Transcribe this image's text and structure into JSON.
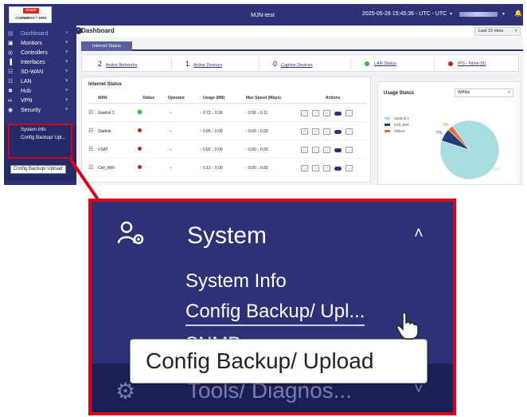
{
  "topbar": {
    "logo_top": "ezuzo",
    "logo_bottom": "COMMBOX™ EDG",
    "app_title": "MJN-test",
    "datetime": "2025-05-28 15:45:36 - UTC - UTC",
    "caret": "▾",
    "bell": "🔔"
  },
  "sidebar": {
    "items": [
      {
        "icon": "▤",
        "label": "Dashboard",
        "active": true
      },
      {
        "icon": "▣",
        "label": "Monitors"
      },
      {
        "icon": "◎",
        "label": "Controllers"
      },
      {
        "icon": "▐",
        "label": "Interfaces"
      },
      {
        "icon": "☷",
        "label": "SD-WAN"
      },
      {
        "icon": "☷",
        "label": "LAN"
      },
      {
        "icon": "✱",
        "label": "Hub"
      },
      {
        "icon": "∞",
        "label": "VPN"
      },
      {
        "icon": "◉",
        "label": "Security"
      }
    ],
    "chevron": "˅",
    "submenu": [
      "System Info",
      "Config Backup/ Upl..."
    ],
    "tooltip": "Config Backup/ Upload"
  },
  "main": {
    "page_title": "Dashboard",
    "time_range": "Last 15 mins",
    "tab": "Internet Status",
    "stats": [
      {
        "count": "2",
        "label": "Active Networks"
      },
      {
        "count": "1",
        "label": "Active Devices"
      },
      {
        "count": "0",
        "label": "Captive Devices"
      },
      {
        "label": "LAN Status",
        "color": "#3cb44b"
      },
      {
        "label": "IPS - None (0)",
        "color": "#b3261e"
      }
    ]
  },
  "internet_status": {
    "title": "Internet Status",
    "columns": [
      "WAN",
      "Status",
      "Operator",
      "Usage (MB)",
      "Max Speed (Mbps)",
      "Actions"
    ],
    "rows": [
      {
        "wan": "Starlink 2",
        "status": "green",
        "operator": "–",
        "usage": "↑ 0.72  ↓ 0.99",
        "speed": "↑ 0.06  ↓ 0.11"
      },
      {
        "wan": "Starlink",
        "status": "red",
        "operator": "–",
        "usage": "↑ 0.05  ↓ 0.00",
        "speed": "↑ 0.00  ↓ 0.00"
      },
      {
        "wan": "VSAT",
        "status": "red",
        "operator": "–",
        "usage": "↑ 0.02  ↓ 0.00",
        "speed": "↑ 0.00  ↓ 0.00"
      },
      {
        "wan": "Cell_WiFi",
        "status": "red",
        "operator": "–",
        "usage": "↑ 0.13  ↓ 0.00",
        "speed": "↑ 0.00  ↓ 0.00"
      }
    ],
    "status_colors": {
      "green": "#3cb44b",
      "red": "#b3261e"
    },
    "action_icons": [
      "chart-icon",
      "settings-icon",
      "speed-icon",
      "toggle-icon",
      "arrow-right-icon"
    ]
  },
  "usage_status": {
    "title": "Usage Status",
    "selected": "WANs",
    "legend": [
      {
        "label": "Starlink 2",
        "color": "#a9dce0"
      },
      {
        "label": "Cell_WiFi",
        "color": "#1f3d78"
      },
      {
        "label": "Others",
        "color": "#e0703c"
      }
    ],
    "slices": [
      {
        "label": "90%",
        "value": 90,
        "color": "#a9dce0"
      },
      {
        "label": "7%",
        "value": 7,
        "color": "#1f3d78"
      },
      {
        "label": "3%",
        "value": 3,
        "color": "#e0703c"
      }
    ]
  },
  "zoom": {
    "section_label": "System",
    "caret": "˄",
    "submenu": [
      "System Info",
      "Config Backup/ Upl...",
      "SNMP"
    ],
    "tooltip": "Config Backup/ Upload",
    "next_section": "Tools/ Diagnos...",
    "next_caret": "˅"
  },
  "colors": {
    "nav": "#2e3176",
    "highlight": "#d8001a"
  }
}
